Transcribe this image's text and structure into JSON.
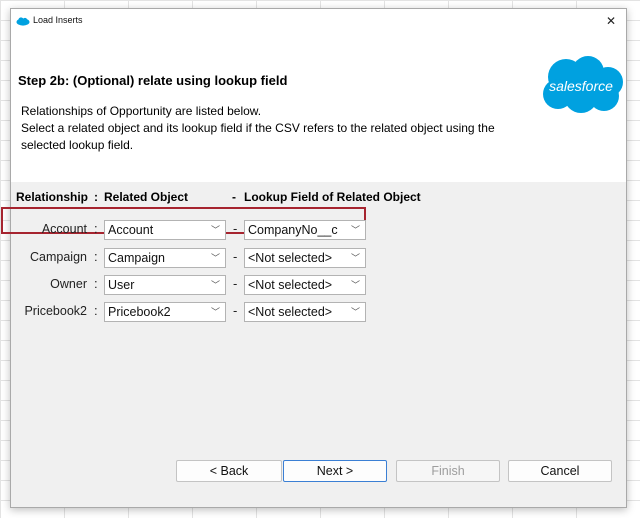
{
  "window": {
    "title": "Load Inserts",
    "close_symbol": "✕"
  },
  "header": {
    "step_title": "Step 2b: (Optional) relate using lookup field",
    "description_lines": [
      "Relationships of Opportunity are listed below.",
      "Select a related object and its lookup field if the CSV refers to the related object using the",
      "selected lookup field."
    ],
    "logo_text": "salesforce"
  },
  "table": {
    "headers": {
      "relationship": "Relationship",
      "colon": ":",
      "related_object": "Related Object",
      "dash": "-",
      "lookup_field": "Lookup Field of Related Object"
    },
    "rows": [
      {
        "relationship": "Account",
        "related_object": "Account",
        "lookup_field": "CompanyNo__c",
        "highlighted": true
      },
      {
        "relationship": "Campaign",
        "related_object": "Campaign",
        "lookup_field": "<Not selected>",
        "highlighted": false
      },
      {
        "relationship": "Owner",
        "related_object": "User",
        "lookup_field": "<Not selected>",
        "highlighted": false
      },
      {
        "relationship": "Pricebook2",
        "related_object": "Pricebook2",
        "lookup_field": "<Not selected>",
        "highlighted": false
      }
    ]
  },
  "buttons": {
    "back": "< Back",
    "next": "Next >",
    "finish": "Finish",
    "cancel": "Cancel"
  },
  "colors": {
    "brand": "#00a1e0",
    "highlight_border": "#a6242f",
    "primary_border": "#3b7fd4"
  }
}
